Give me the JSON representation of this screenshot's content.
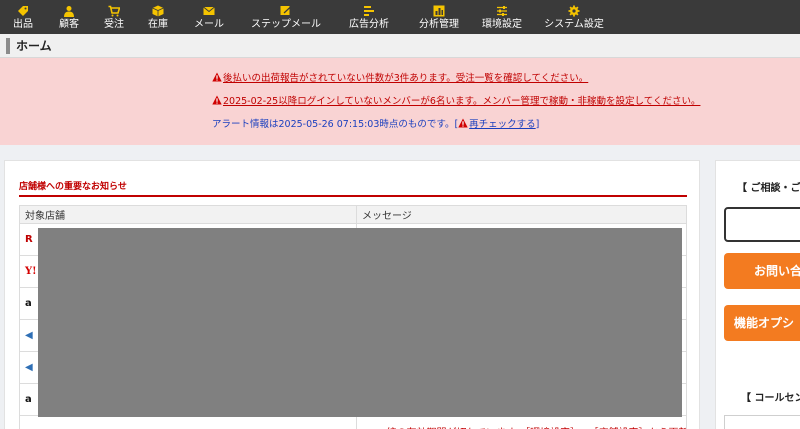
{
  "nav": [
    {
      "label": "出品",
      "icon": "tag-icon"
    },
    {
      "label": "顧客",
      "icon": "person-icon"
    },
    {
      "label": "受注",
      "icon": "cart-icon"
    },
    {
      "label": "在庫",
      "icon": "box-icon"
    },
    {
      "label": "メール",
      "icon": "envelope-icon"
    },
    {
      "label": "ステップメール",
      "icon": "mail-edit-icon"
    },
    {
      "label": "広告分析",
      "icon": "list-icon"
    },
    {
      "label": "分析管理",
      "icon": "bar-chart-icon"
    },
    {
      "label": "環境設定",
      "icon": "sliders-icon"
    },
    {
      "label": "システム設定",
      "icon": "gear-icon"
    }
  ],
  "page_title": "ホーム",
  "alerts": {
    "line1": "後払いの出荷報告がされていない件数が3件あります。受注一覧を確認してください。",
    "line2": "2025-02-25以降ログインしていないメンバーが6名います。メンバー管理で稼動・非稼動を設定してください。",
    "info_text": "アラート情報は2025-05-26 07:15:03時点のものです。[",
    "recheck_link": "再チェックする",
    "info_close": "]"
  },
  "notices": {
    "title": "店舗様への重要なお知らせ",
    "columns": [
      "対象店舗",
      "メッセージ"
    ],
    "rows": [
      {
        "shop_badge": "R",
        "message": ""
      },
      {
        "shop_badge": "Y!",
        "message": ""
      },
      {
        "shop_badge": "a",
        "message": ""
      },
      {
        "shop_badge": "◀",
        "message": ""
      },
      {
        "shop_badge": "◀",
        "message": ""
      },
      {
        "shop_badge": "a",
        "message": ""
      },
      {
        "shop_badge": "",
        "message": "APIM統の有効期間が切れています。［環境設定］→［店舗設定］から更新"
      }
    ]
  },
  "right_panel": {
    "heading": "【 ご相談・ご",
    "contact_button": "お問い合",
    "option_button": "機能オプシ",
    "call_heading": "【 コールセン"
  },
  "colors": {
    "nav_bg": "#3a3a3a",
    "nav_icon": "#f5c400",
    "alert_bg": "#f9d3d3",
    "alert_red": "#c00000",
    "alert_blue": "#1a3fbf",
    "accent_orange": "#f37b20"
  }
}
